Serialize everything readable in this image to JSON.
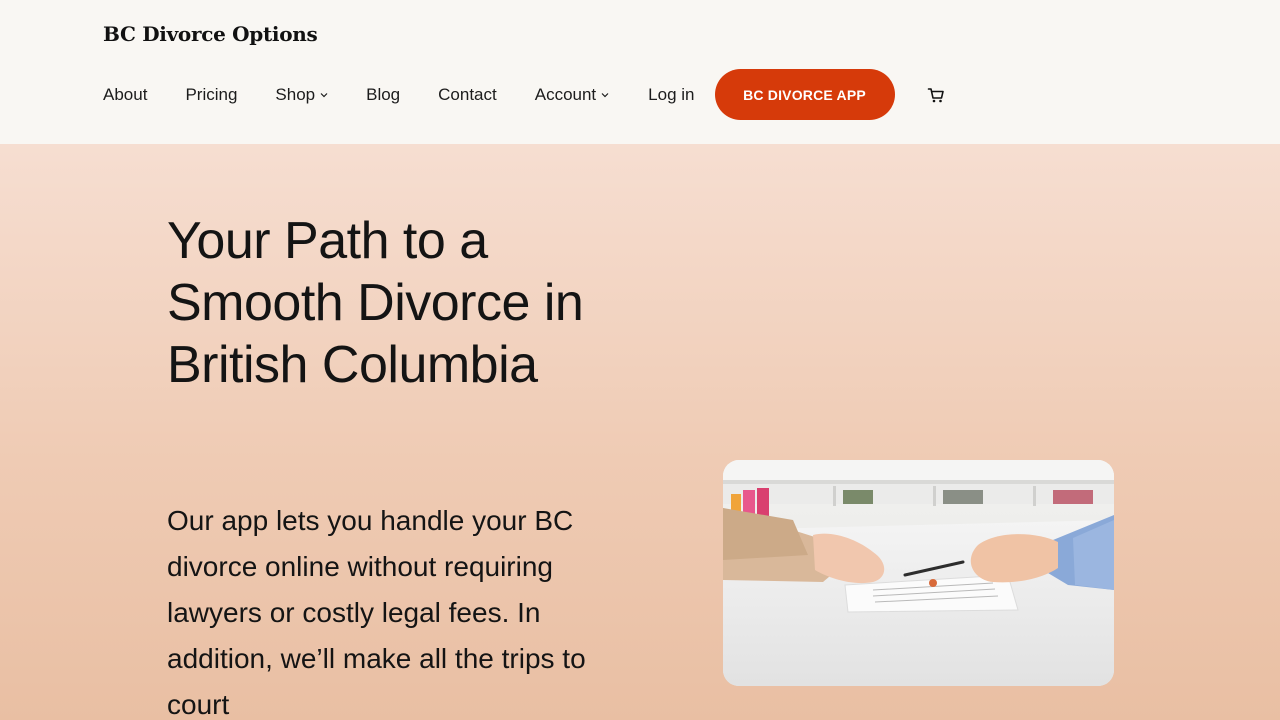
{
  "site": {
    "title": "BC Divorce Options"
  },
  "nav": {
    "items": [
      {
        "label": "About"
      },
      {
        "label": "Pricing"
      },
      {
        "label": "Shop"
      },
      {
        "label": "Blog"
      },
      {
        "label": "Contact"
      },
      {
        "label": "Account"
      },
      {
        "label": "Log in"
      }
    ],
    "cta_label": "BC DIVORCE APP",
    "cart_icon": "cart-icon"
  },
  "hero": {
    "title": "Your Path to a Smooth Divorce in British Columbia",
    "text": "Our app lets you handle your BC divorce online without requiring lawyers or costly legal fees. In addition, we’ll make all the trips to court"
  },
  "colors": {
    "accent": "#d63a0a",
    "header_bg": "#f9f7f3",
    "hero_gradient_top": "#f6ded1",
    "hero_gradient_bottom": "#e9bfa3"
  }
}
